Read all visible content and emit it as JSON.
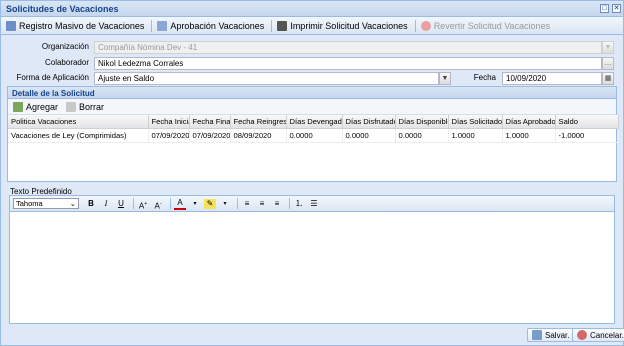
{
  "window": {
    "title": "Solicitudes de Vacaciones"
  },
  "toolbar": {
    "btn1": "Registro Masivo de Vacaciones",
    "btn2": "Aprobación Vacaciones",
    "btn3": "Imprimir Solicitud Vacaciones",
    "btn4": "Revertir Solicitud Vacaciones"
  },
  "form": {
    "org_label": "Organización",
    "org_value": "Compañía Nómina Dev - 41",
    "colab_label": "Colaborador",
    "colab_value": "Nikol  Ledezma Corrales",
    "forma_label": "Forma de Aplicación",
    "forma_value": "Ajuste en Saldo",
    "fecha_label": "Fecha",
    "fecha_value": "10/09/2020"
  },
  "detail": {
    "title": "Detalle de la Solicitud",
    "add_label": "Agregar",
    "delete_label": "Borrar",
    "columns": [
      "Politica Vacaciones",
      "Fecha Inicial",
      "Fecha Final",
      "Fecha Reingreso",
      "Días Devengados",
      "Días Disfrutados",
      "Días Disponibles",
      "Días Solicitados",
      "Días Aprobados",
      "Saldo"
    ],
    "rows": [
      [
        "Vacaciones de Ley (Comprimidas)",
        "07/09/2020",
        "07/09/2020",
        "08/09/2020",
        "0.0000",
        "0.0000",
        "0.0000",
        "1.0000",
        "1.0000",
        "-1.0000"
      ]
    ]
  },
  "editor": {
    "label": "Texto Predefinido",
    "font": "Tahoma"
  },
  "footer": {
    "save_label": "Salvar.",
    "cancel_label": "Cancelar."
  },
  "colors": {
    "accent": "#15428b",
    "border": "#99bbe8",
    "panel_bg": "#dfe8f6"
  }
}
